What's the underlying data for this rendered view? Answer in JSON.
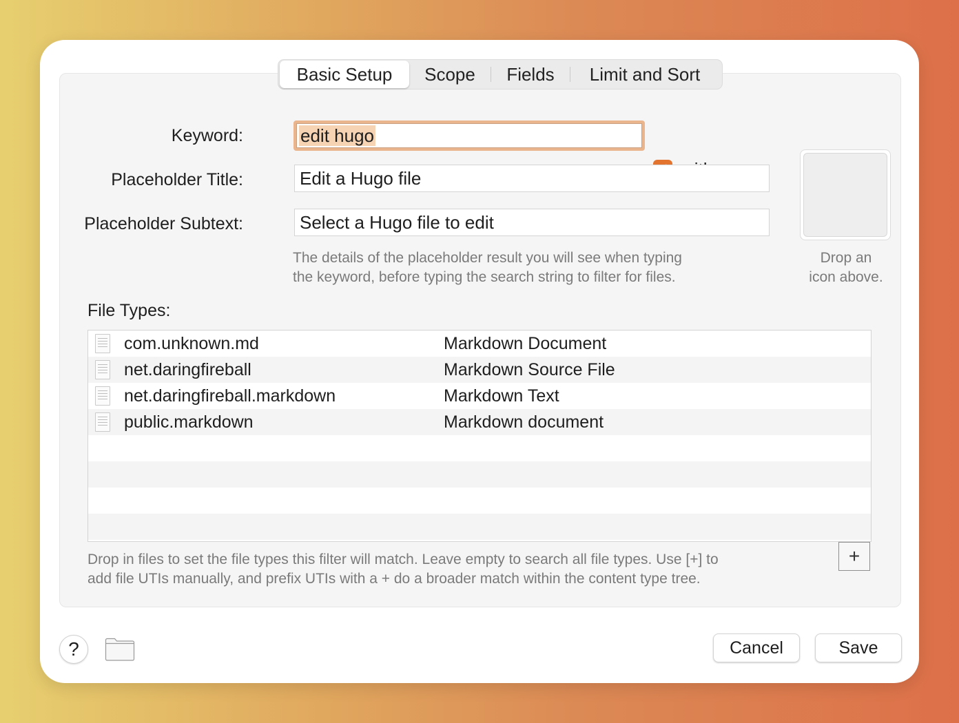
{
  "tabs": [
    {
      "label": "Basic Setup",
      "active": true
    },
    {
      "label": "Scope",
      "active": false
    },
    {
      "label": "Fields",
      "active": false
    },
    {
      "label": "Limit and Sort",
      "active": false
    }
  ],
  "form": {
    "keyword_label": "Keyword:",
    "keyword_value": "edit hugo",
    "with_space_label": "with space",
    "with_space_checked": true,
    "placeholder_title_label": "Placeholder Title:",
    "placeholder_title_value": "Edit a Hugo file",
    "placeholder_subtext_label": "Placeholder Subtext:",
    "placeholder_subtext_value": "Select a Hugo file to edit",
    "hint_line1": "The details of the placeholder result you will see when typing",
    "hint_line2": "the keyword, before typing the search string to filter for files."
  },
  "icon_well": {
    "line1": "Drop an",
    "line2": "icon above."
  },
  "file_types": {
    "title": "File Types:",
    "rows": [
      {
        "uti": "com.unknown.md",
        "description": "Markdown Document"
      },
      {
        "uti": "net.daringfireball",
        "description": "Markdown Source File"
      },
      {
        "uti": "net.daringfireball.markdown",
        "description": "Markdown Text"
      },
      {
        "uti": "public.markdown",
        "description": "Markdown document"
      }
    ],
    "add_label": "+",
    "hint_line1": "Drop in files to set the file types this filter will match. Leave empty to search all file types. Use [+] to",
    "hint_line2": "add file UTIs manually, and prefix UTIs with a + do a broader match within the content type tree."
  },
  "footer": {
    "help_label": "?",
    "cancel_label": "Cancel",
    "save_label": "Save"
  },
  "colors": {
    "accent": "#e2742f",
    "focus_ring": "#eab48c"
  }
}
